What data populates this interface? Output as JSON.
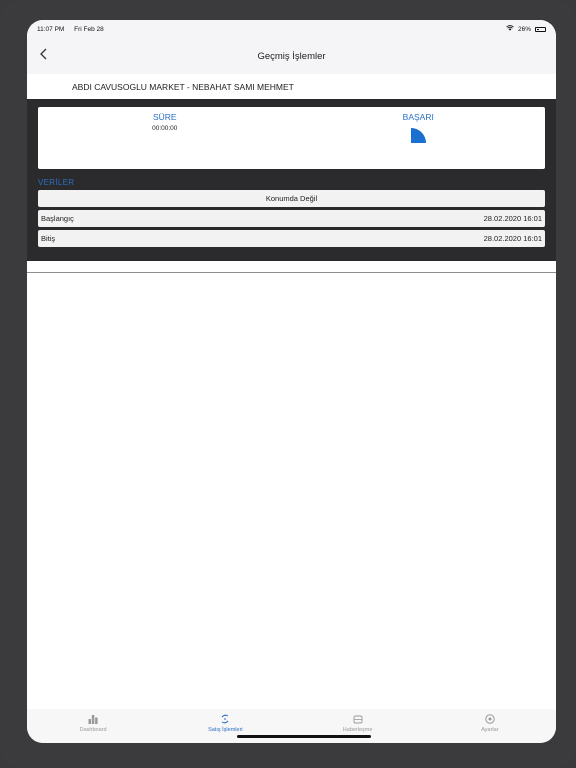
{
  "status": {
    "time": "11:07 PM",
    "date": "Fri Feb 28",
    "battery": "26%"
  },
  "nav": {
    "title": "Geçmiş İşlemler"
  },
  "subheader": {
    "text": "ABDI CAVUSOGLU MARKET - NEBAHAT SAMI MEHMET"
  },
  "stats": {
    "duration_label": "SÜRE",
    "duration_value": "00:00:00",
    "success_label": "BAŞARI",
    "success_fraction": 0.25,
    "accent": "#1a6fd1"
  },
  "data_section": {
    "title": "VERİLER",
    "location_status": "Konumda Değil",
    "rows": [
      {
        "label": "Başlangıç",
        "value": "28.02.2020 16:01"
      },
      {
        "label": "Bitiş",
        "value": "28.02.2020 16:01"
      }
    ]
  },
  "tabs": [
    {
      "label": "Dashboard",
      "icon": "bar-chart-icon"
    },
    {
      "label": "Satış İşlemleri",
      "icon": "sales-icon"
    },
    {
      "label": "Haberleşme",
      "icon": "car-icon"
    },
    {
      "label": "Ayarlar",
      "icon": "gear-icon"
    }
  ]
}
